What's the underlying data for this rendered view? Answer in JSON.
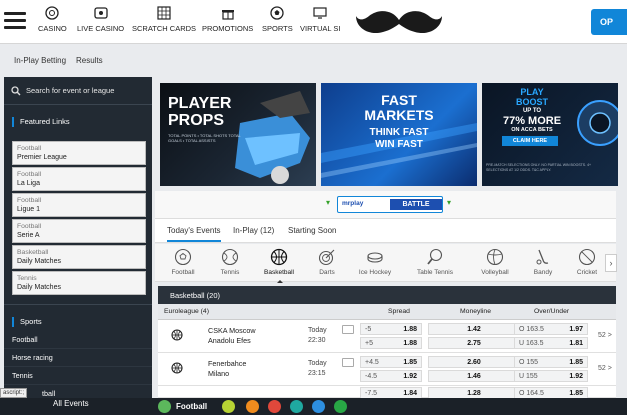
{
  "nav": {
    "items": [
      {
        "label": "CASINO",
        "icon": "casino-chip-icon"
      },
      {
        "label": "LIVE CASINO",
        "icon": "live-casino-icon"
      },
      {
        "label": "SCRATCH CARDS",
        "icon": "scratch-card-icon"
      },
      {
        "label": "PROMOTIONS",
        "icon": "gift-icon"
      },
      {
        "label": "SPORTS",
        "icon": "soccer-ball-icon"
      },
      {
        "label": "VIRTUAL SI",
        "icon": "virtual-sports-icon"
      }
    ],
    "open_label": "OP"
  },
  "subnav": {
    "inplay": "In-Play Betting",
    "results": "Results"
  },
  "sidebar": {
    "search_placeholder": "Search for event or league",
    "featured_title": "Featured Links",
    "featured": [
      {
        "sport": "Football",
        "name": "Premier League"
      },
      {
        "sport": "Football",
        "name": "La Liga"
      },
      {
        "sport": "Football",
        "name": "Ligue 1"
      },
      {
        "sport": "Football",
        "name": "Serie A"
      },
      {
        "sport": "Basketball",
        "name": "Daily Matches"
      },
      {
        "sport": "Tennis",
        "name": "Daily Matches"
      }
    ],
    "sports_title": "Sports",
    "sports": [
      "Football",
      "Horse racing",
      "Tennis",
      "tball"
    ]
  },
  "tooltip": "ascript:;",
  "banners": {
    "props": {
      "line1": "PLAYER",
      "line2": "PROPS",
      "small": "TOTAL POINTS • TOTAL SHOTS TOTAL GOALS • TOTAL ASSISTS"
    },
    "fast": {
      "line1": "FAST",
      "line2": "MARKETS",
      "line3": "THINK FAST",
      "line4": "WIN FAST"
    },
    "boost": {
      "line1": "PLAY",
      "line2": "BOOST",
      "line3": "UP TO",
      "line4": "77% MORE",
      "line5": "ON ACCA BETS",
      "cta": "CLAIM HERE",
      "fine": "PRE-MATCH SELECTIONS ONLY. NO PARTIAL WIN BOOSTS. 4+ SELECTIONS AT 1/2 ODDS. T&C APPLY."
    }
  },
  "battle": {
    "logo": "mrplay",
    "label": "BATTLE"
  },
  "tabs": [
    "Today's Events",
    "In-Play (12)",
    "Starting Soon"
  ],
  "sports_strip": [
    {
      "label": "Football",
      "icon": "football-icon"
    },
    {
      "label": "Tennis",
      "icon": "tennis-icon"
    },
    {
      "label": "Basketball",
      "icon": "basketball-icon"
    },
    {
      "label": "Darts",
      "icon": "darts-icon"
    },
    {
      "label": "Ice Hockey",
      "icon": "ice-hockey-icon"
    },
    {
      "label": "Table Tennis",
      "icon": "table-tennis-icon"
    },
    {
      "label": "Volleyball",
      "icon": "volleyball-icon"
    },
    {
      "label": "Bandy",
      "icon": "bandy-icon"
    },
    {
      "label": "Cricket",
      "icon": "cricket-icon"
    }
  ],
  "events": {
    "header": "Basketball (20)",
    "league": "Euroleague (4)",
    "col_spread": "Spread",
    "col_moneyline": "Moneyline",
    "col_ou": "Over/Under",
    "rows": [
      {
        "home": "CSKA Moscow",
        "away": "Anadolu Efes",
        "day": "Today",
        "time": "22:30",
        "spread": [
          {
            "line": "-5",
            "price": "1.88"
          },
          {
            "line": "+5",
            "price": "1.88"
          }
        ],
        "moneyline": [
          "1.42",
          "2.75"
        ],
        "ou": [
          {
            "line": "O 163.5",
            "price": "1.97"
          },
          {
            "line": "U 163.5",
            "price": "1.81"
          }
        ],
        "more": "52 >"
      },
      {
        "home": "Fenerbahce",
        "away": "Milano",
        "day": "Today",
        "time": "23:15",
        "spread": [
          {
            "line": "+4.5",
            "price": "1.85"
          },
          {
            "line": "-4.5",
            "price": "1.92"
          }
        ],
        "moneyline": [
          "2.60",
          "1.46"
        ],
        "ou": [
          {
            "line": "O 155",
            "price": "1.85"
          },
          {
            "line": "U 155",
            "price": "1.92"
          }
        ],
        "more": "52 >"
      },
      {
        "home": "",
        "away": "",
        "day": "",
        "time": "",
        "spread": [
          {
            "line": "-7.5",
            "price": "1.84"
          },
          {
            "line": "",
            "price": ""
          }
        ],
        "moneyline": [
          "1.28",
          ""
        ],
        "ou": [
          {
            "line": "O 164.5",
            "price": "1.85"
          },
          {
            "line": "",
            "price": ""
          }
        ],
        "more": ""
      }
    ]
  },
  "bottombar": {
    "all_events": "All Events",
    "football": "Football"
  },
  "colors": {
    "accent": "#1186d8",
    "sidebar": "#222a33",
    "green": "#37a32c"
  }
}
